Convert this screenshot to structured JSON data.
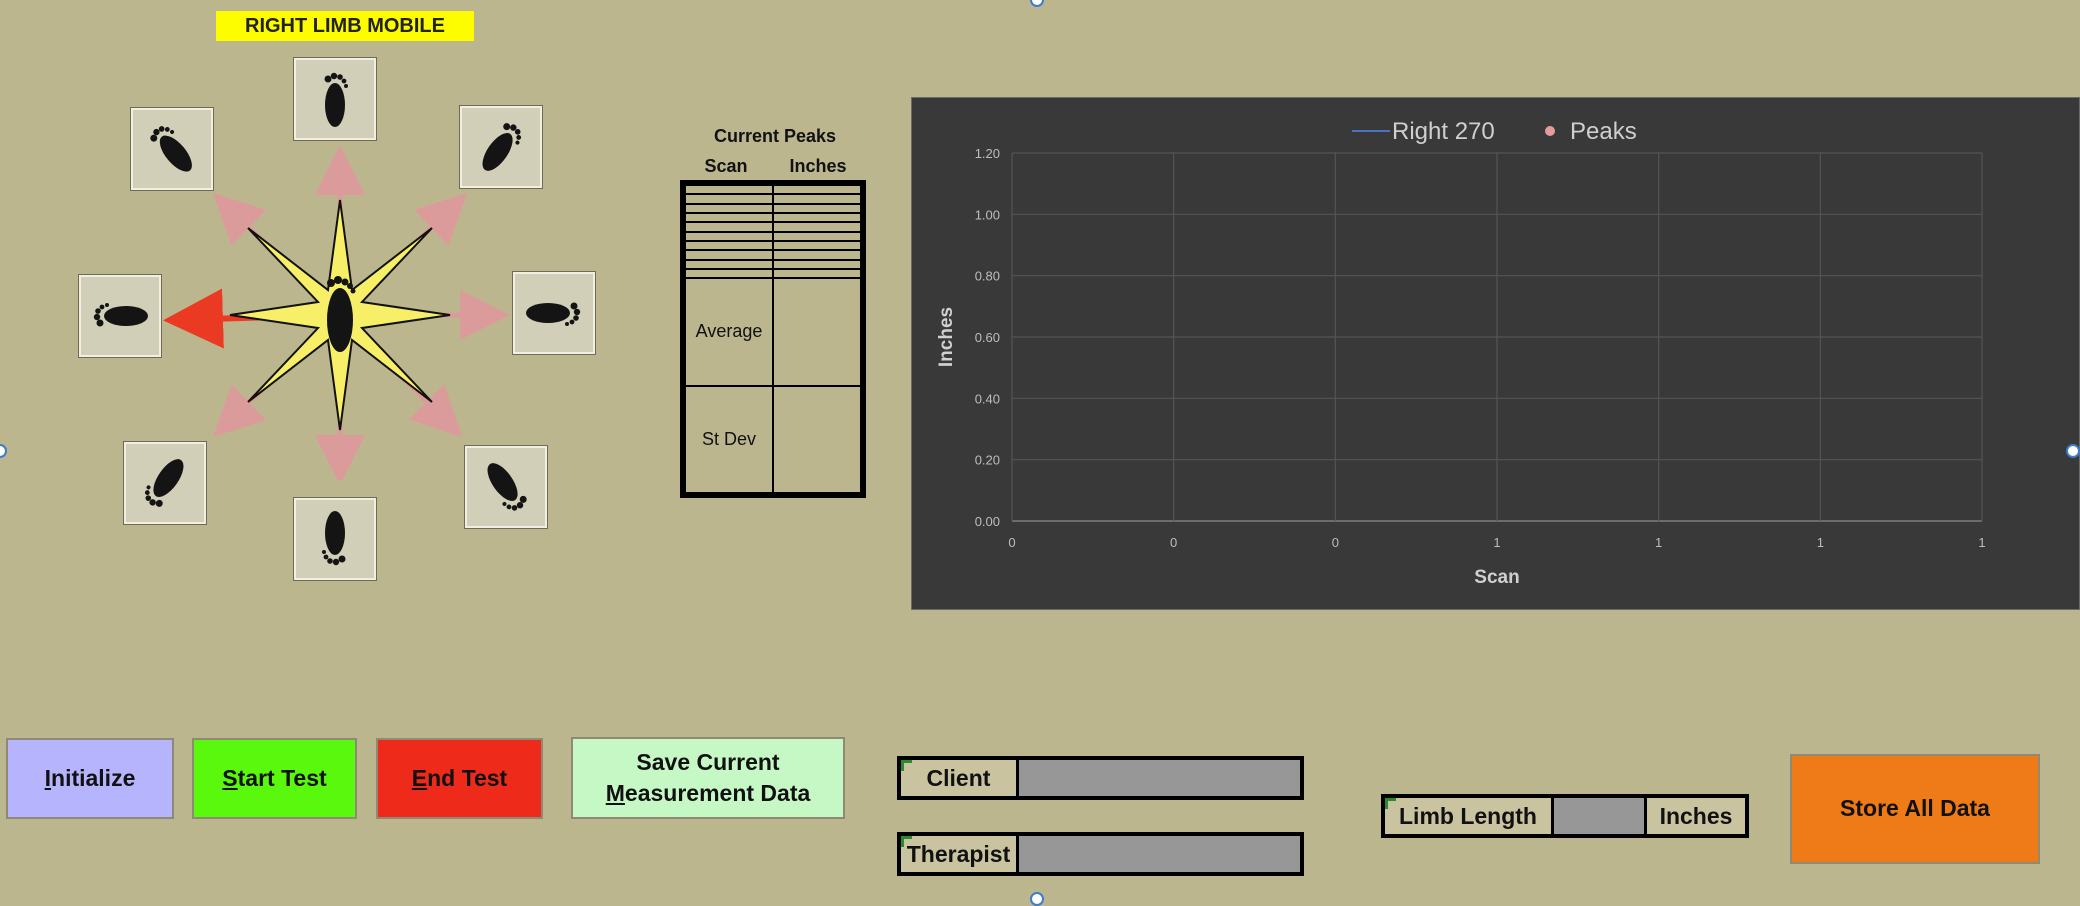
{
  "title": "RIGHT LIMB MOBILE",
  "foot_icons": [
    "foot-up-icon",
    "foot-up-right-icon",
    "foot-right-icon",
    "foot-down-right-icon",
    "foot-down-icon",
    "foot-down-left-icon",
    "foot-left-icon",
    "foot-up-left-icon"
  ],
  "colors": {
    "arrow_default": "#dc9b9b",
    "arrow_active": "#ea3a24",
    "star": "#f7ef67",
    "chart_bg": "#393939"
  },
  "peaks": {
    "title": "Current Peaks",
    "col_scan": "Scan",
    "col_inches": "Inches",
    "rows": [
      "",
      "",
      "",
      "",
      "",
      "",
      "",
      "",
      "",
      ""
    ],
    "average_label": "Average",
    "stdev_label": "St Dev"
  },
  "chart_data": {
    "type": "line",
    "legend": [
      {
        "name": "Right 270",
        "marker": "line",
        "color": "#4a72c4"
      },
      {
        "name": "Peaks",
        "marker": "dot",
        "color": "#e59c9c"
      }
    ],
    "legend_position": "top",
    "xlabel": "Scan",
    "ylabel": "Inches",
    "y_ticks": [
      "0.00",
      "0.20",
      "0.40",
      "0.60",
      "0.80",
      "1.00",
      "1.20"
    ],
    "x_ticks": [
      "0",
      "0",
      "0",
      "1",
      "1",
      "1",
      "1"
    ],
    "ylim": [
      0,
      1.2
    ],
    "grid": true,
    "series": [
      {
        "name": "Right 270",
        "values": []
      },
      {
        "name": "Peaks",
        "values": []
      }
    ]
  },
  "buttons": {
    "initialize": {
      "u": "I",
      "rest": "nitialize",
      "color": "#b6b4fd"
    },
    "start": {
      "u": "S",
      "rest": "tart Test",
      "color": "#59f80d"
    },
    "end": {
      "u": "E",
      "rest": "nd Test",
      "color": "#ee2b1a"
    },
    "save_line1": "Save Current",
    "save_u": "M",
    "save_rest": "easurement Data",
    "save_color": "#c5f8c4",
    "store": "Store All Data",
    "store_color": "#ef7a18"
  },
  "fields": {
    "client_label": "Client",
    "client_value": "",
    "therapist_label": "Therapist",
    "therapist_value": "",
    "limb_label": "Limb Length",
    "limb_value": "",
    "limb_unit": "Inches"
  }
}
